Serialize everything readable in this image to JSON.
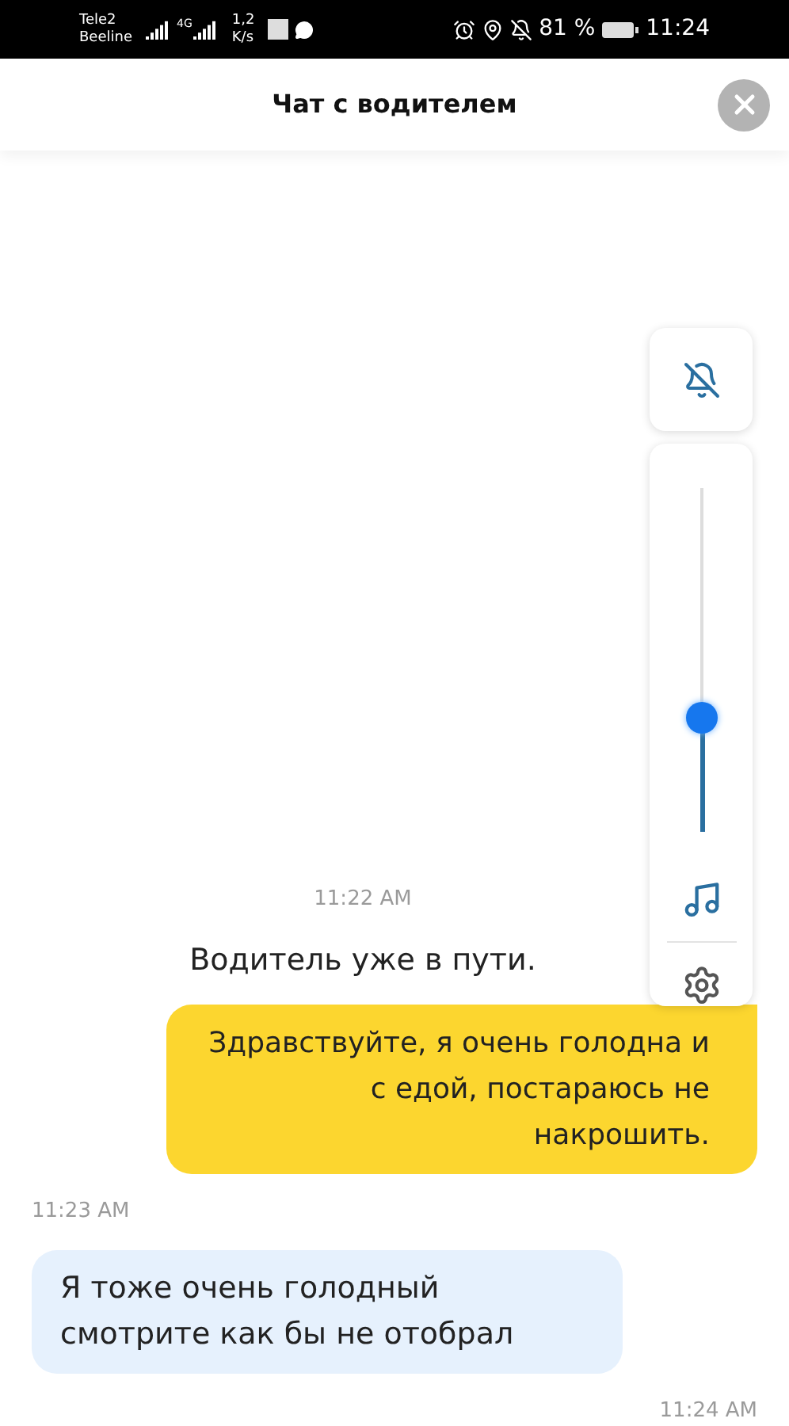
{
  "status_bar": {
    "carriers": [
      "Tele2",
      "Beeline"
    ],
    "network": "4G",
    "speed": "1,2",
    "speed_unit": "K/s",
    "battery": "81 %",
    "time": "11:24"
  },
  "header": {
    "title": "Чат с водителем"
  },
  "sound_panel": {
    "muted": true,
    "level": 0.33
  },
  "messages": [
    {
      "kind": "time_center",
      "text": "11:22 AM"
    },
    {
      "kind": "system",
      "text": "Водитель уже в пути."
    },
    {
      "kind": "outgoing",
      "text": "Здравствуйте, я очень голодна и с едой, постараюсь не накрошить."
    },
    {
      "kind": "time_left",
      "text": "11:23 AM"
    },
    {
      "kind": "incoming",
      "text": "Я тоже очень голодный смотрите как бы не отобрал"
    },
    {
      "kind": "time_right",
      "text": "11:24 AM"
    }
  ]
}
